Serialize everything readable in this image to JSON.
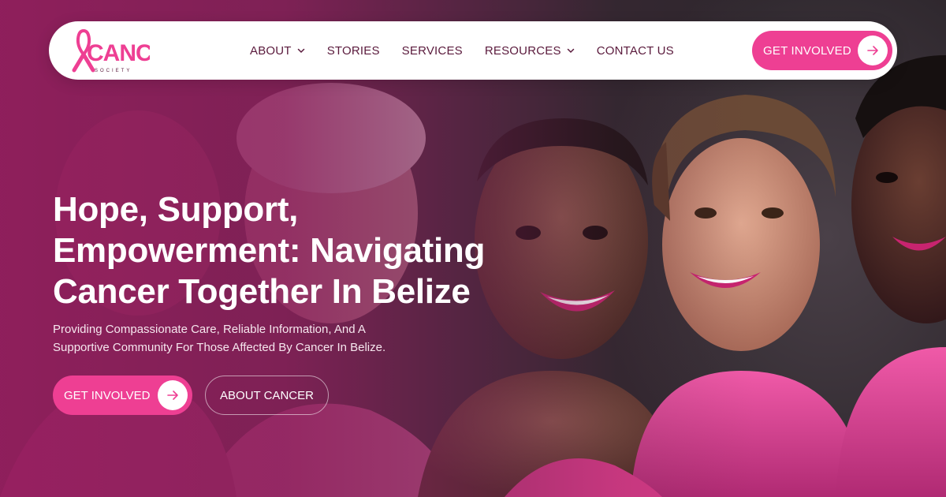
{
  "brand": {
    "logo_text": "CANCER",
    "logo_subtext": "SOCIETY",
    "accent_color": "#ee3f93",
    "nav_text_color": "#5a1a3c"
  },
  "nav": {
    "items": [
      {
        "label": "ABOUT",
        "has_dropdown": true
      },
      {
        "label": "STORIES",
        "has_dropdown": false
      },
      {
        "label": "SERVICES",
        "has_dropdown": false
      },
      {
        "label": "RESOURCES",
        "has_dropdown": true
      },
      {
        "label": "CONTACT US",
        "has_dropdown": false
      }
    ],
    "cta_label": "GET INVOLVED"
  },
  "hero": {
    "headline_lines": [
      "Hope, Support,",
      "Empowerment: Navigating",
      "Cancer Together In Belize"
    ],
    "subtext_lines": [
      "Providing Compassionate Care, Reliable Information, And A",
      "Supportive Community For Those Affected By Cancer In Belize."
    ],
    "primary_button": "GET INVOLVED",
    "secondary_button": "ABOUT CANCER"
  }
}
